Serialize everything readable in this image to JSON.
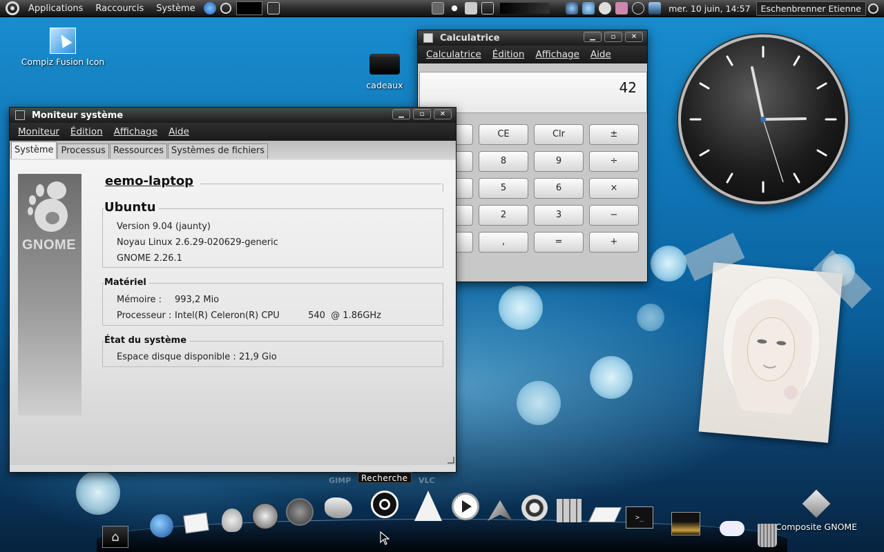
{
  "top_panel": {
    "menus": [
      "Applications",
      "Raccourcis",
      "Système"
    ],
    "clock": "mer. 10 juin, 14:57",
    "user": "Eschenbrenner Etienne"
  },
  "desktop": {
    "icons": [
      {
        "label": "Compiz Fusion Icon"
      },
      {
        "label": "cadeaux"
      },
      {
        "label": "Composite GNOME"
      }
    ]
  },
  "system_monitor": {
    "title": "Moniteur système",
    "menu": [
      "Moniteur",
      "Édition",
      "Affichage",
      "Aide"
    ],
    "tabs": [
      "Système",
      "Processus",
      "Ressources",
      "Systèmes de fichiers"
    ],
    "hostname": "eemo-laptop",
    "logo_text": "GNOME",
    "os": {
      "name": "Ubuntu",
      "version": "Version 9.04 (jaunty)",
      "kernel": "Noyau Linux 2.6.29-020629-generic",
      "gnome": "GNOME 2.26.1"
    },
    "hardware": {
      "title": "Matériel",
      "memory_label": "Mémoire :",
      "memory_value": "993,2 Mio",
      "cpu_label": "Processeur :",
      "cpu_value": "Intel(R) Celeron(R) CPU          540  @ 1.86GHz"
    },
    "status": {
      "title": "État du système",
      "disk": "Espace disque disponible : 21,9 Gio"
    }
  },
  "calculator": {
    "title": "Calculatrice",
    "menu": [
      "Calculatrice",
      "Édition",
      "Affichage",
      "Aide"
    ],
    "display": "42",
    "buttons": [
      [
        "CE",
        "Clr",
        "±"
      ],
      [
        "8",
        "9",
        "÷"
      ],
      [
        "5",
        "6",
        "×"
      ],
      [
        "2",
        "3",
        "−"
      ],
      [
        ",",
        "=",
        "+"
      ]
    ]
  },
  "dock": {
    "tooltip": "Recherche",
    "faded_labels": [
      "GIMP",
      "VLC"
    ]
  },
  "colors": {
    "panel": "#1a1a1a",
    "desktop_blue": "#0f73b4",
    "window_bg": "#dcdcdc"
  }
}
